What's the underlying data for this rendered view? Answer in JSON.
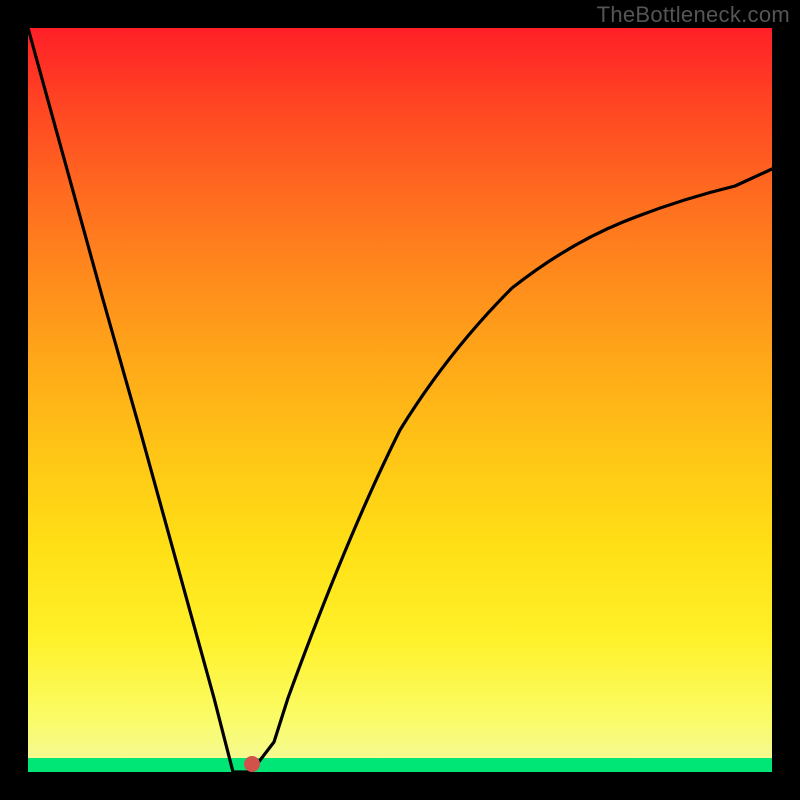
{
  "watermark": "TheBottleneck.com",
  "chart_data": {
    "type": "line",
    "title": "",
    "xlabel": "",
    "ylabel": "",
    "xlim": [
      0,
      1
    ],
    "ylim": [
      0,
      1
    ],
    "x": [
      0.0,
      0.05,
      0.1,
      0.15,
      0.2,
      0.25,
      0.276,
      0.3,
      0.33,
      0.35,
      0.4,
      0.45,
      0.5,
      0.55,
      0.6,
      0.65,
      0.7,
      0.75,
      0.8,
      0.85,
      0.9,
      0.95,
      1.0
    ],
    "values": [
      1.0,
      0.82,
      0.64,
      0.46,
      0.28,
      0.1,
      0.0,
      0.0,
      0.04,
      0.1,
      0.24,
      0.36,
      0.46,
      0.54,
      0.6,
      0.65,
      0.69,
      0.72,
      0.75,
      0.77,
      0.79,
      0.8,
      0.81
    ],
    "marker": {
      "x": 0.3,
      "y": 0.0
    },
    "background_gradient": {
      "top": "#ff1f27",
      "mid": "#ffe016",
      "bottom_band": "#00e676"
    }
  }
}
